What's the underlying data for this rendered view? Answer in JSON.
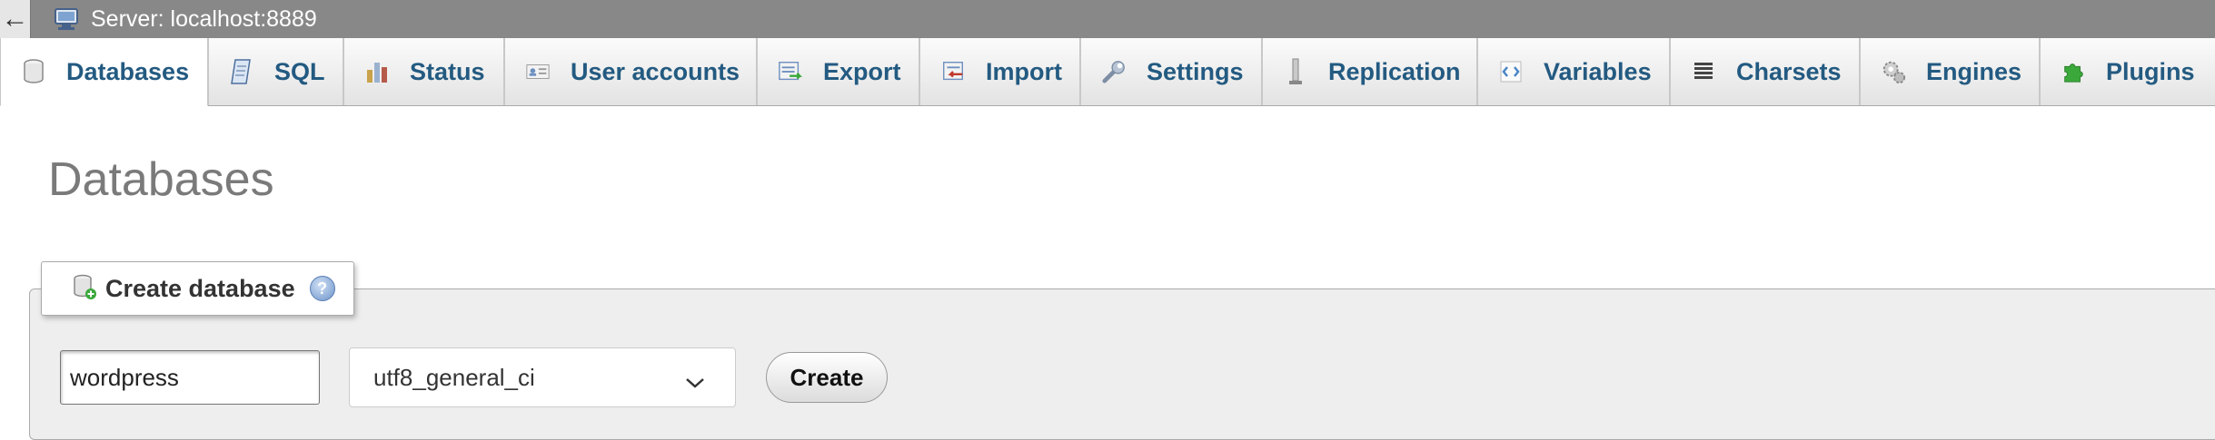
{
  "topbar": {
    "back_glyph": "←",
    "server_label": "Server: localhost:8889",
    "server_icon": "server-icon"
  },
  "tabs": [
    {
      "label": "Databases",
      "icon": "database-icon",
      "active": true
    },
    {
      "label": "SQL",
      "icon": "sql-icon"
    },
    {
      "label": "Status",
      "icon": "status-chart-icon"
    },
    {
      "label": "User accounts",
      "icon": "user-card-icon"
    },
    {
      "label": "Export",
      "icon": "export-icon"
    },
    {
      "label": "Import",
      "icon": "import-icon"
    },
    {
      "label": "Settings",
      "icon": "wrench-icon"
    },
    {
      "label": "Replication",
      "icon": "replication-icon"
    },
    {
      "label": "Variables",
      "icon": "variables-icon"
    },
    {
      "label": "Charsets",
      "icon": "charsets-icon"
    },
    {
      "label": "Engines",
      "icon": "engines-gear-icon"
    },
    {
      "label": "Plugins",
      "icon": "puzzle-icon"
    }
  ],
  "page": {
    "title": "Databases"
  },
  "create_database": {
    "legend": "Create database",
    "help_glyph": "?",
    "name_value": "wordpress",
    "collation_value": "utf8_general_ci",
    "create_label": "Create"
  },
  "colors": {
    "tab_text": "#235a81",
    "topbar_bg": "#888888",
    "fieldset_bg": "#eeeeee",
    "plugin_green": "#3aa83a"
  }
}
